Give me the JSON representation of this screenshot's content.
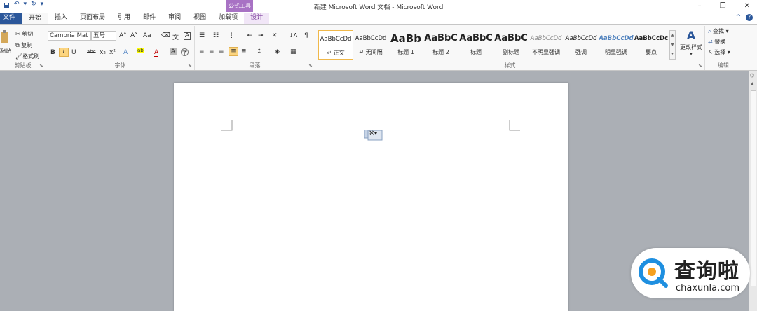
{
  "titlebar": {
    "title": "新建 Microsoft Word 文档 - Microsoft Word",
    "context_tab_title": "公式工具",
    "qat": {
      "save_icon": "save-icon",
      "undo_icon": "undo-icon",
      "redo_icon": "redo-icon",
      "customize_icon": "customize-qat-icon",
      "undo_glyph": "↶",
      "redo_glyph": "↻",
      "dd_glyph": "▾"
    },
    "window_buttons": {
      "minimize": "–",
      "restore": "❐",
      "close": "✕"
    }
  },
  "tabs": [
    {
      "label": "文件"
    },
    {
      "label": "开始"
    },
    {
      "label": "插入"
    },
    {
      "label": "页面布局"
    },
    {
      "label": "引用"
    },
    {
      "label": "邮件"
    },
    {
      "label": "审阅"
    },
    {
      "label": "视图"
    },
    {
      "label": "加载项"
    },
    {
      "label": "设计"
    }
  ],
  "tab_right": {
    "minimize_ribbon": "^",
    "help": "?"
  },
  "ribbon": {
    "clipboard": {
      "label": "剪贴板",
      "paste": "粘贴",
      "cut": "剪切",
      "copy": "复制",
      "format_painter": "格式刷"
    },
    "font": {
      "label": "字体",
      "font_name": "Cambria Mat",
      "font_size": "五号",
      "grow": "A˄",
      "shrink": "A˅",
      "change_case": "Aa",
      "clear": "⌫",
      "phonetic": "文",
      "border_char": "A",
      "bold": "B",
      "italic": "I",
      "underline": "U",
      "strike": "abc",
      "sub": "x₂",
      "sup": "x²",
      "effects": "A",
      "highlight": "ab",
      "color": "A",
      "shading": "A",
      "enclose": "字"
    },
    "paragraph": {
      "label": "段落",
      "bullets": "☰",
      "numbering": "☷",
      "multilevel": "⋮",
      "dec_indent": "⇤",
      "inc_indent": "⇥",
      "chinese_layout": "✕",
      "sort": "↓A",
      "show_marks": "¶",
      "align_left": "≡",
      "align_center": "≡",
      "align_right": "≡",
      "justify": "≡",
      "distributed": "≣",
      "line_spacing": "↕",
      "shading": "◈",
      "borders": "▦"
    },
    "styles": {
      "label": "样式",
      "change_styles": "更改样式",
      "items": [
        {
          "sample": "AaBbCcDd",
          "name": "↵ 正文"
        },
        {
          "sample": "AaBbCcDd",
          "name": "↵ 无间隔"
        },
        {
          "sample": "AaBb",
          "name": "标题 1"
        },
        {
          "sample": "AaBbC",
          "name": "标题 2"
        },
        {
          "sample": "AaBbC",
          "name": "标题"
        },
        {
          "sample": "AaBbC",
          "name": "副标题"
        },
        {
          "sample": "AaBbCcDd",
          "name": "不明显强调"
        },
        {
          "sample": "AaBbCcDd",
          "name": "强调"
        },
        {
          "sample": "AaBbCcDd",
          "name": "明显强调"
        },
        {
          "sample": "AaBbCcDc",
          "name": "要点"
        }
      ]
    },
    "editing": {
      "label": "编辑",
      "find": "查找",
      "replace": "替换",
      "select": "选择"
    }
  },
  "document": {
    "cursor_glyph": "ℵ▾"
  },
  "watermark": {
    "brand": "查询啦",
    "url": "chaxunla.com"
  },
  "colors": {
    "file_tab": "#2b579a",
    "context_tab": "#a872c4",
    "accent": "#2b579a",
    "doc_bg": "#abafb5"
  }
}
